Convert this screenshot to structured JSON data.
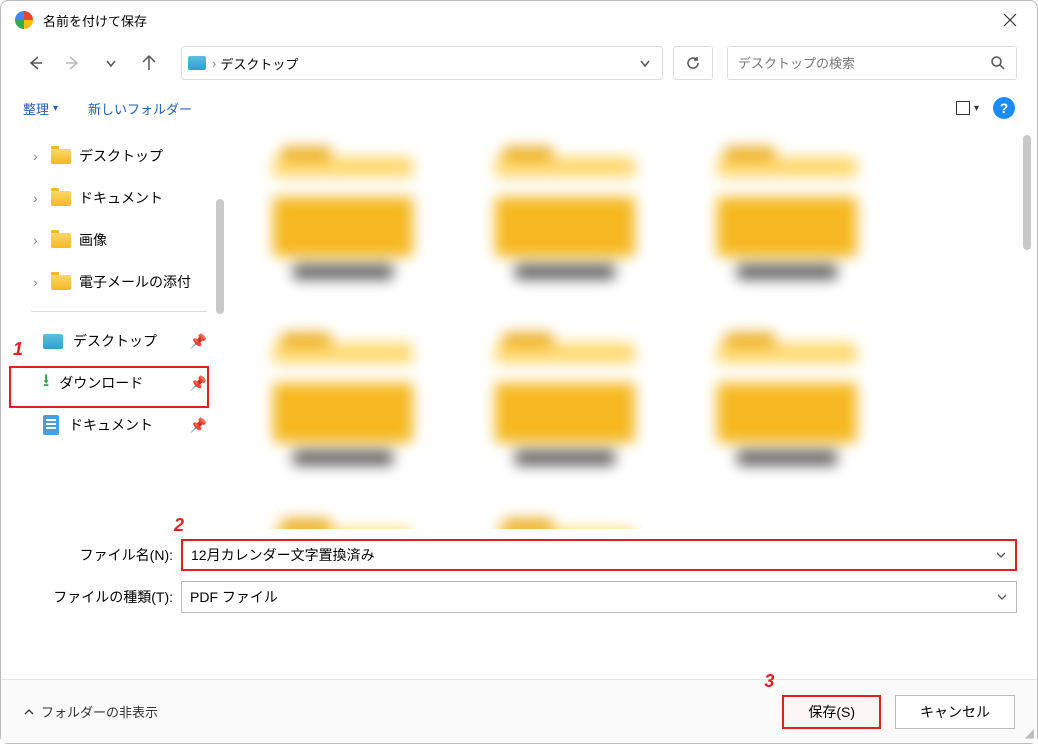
{
  "titlebar": {
    "title": "名前を付けて保存"
  },
  "nav": {
    "breadcrumb": "デスクトップ",
    "search_placeholder": "デスクトップの検索"
  },
  "toolbar": {
    "organize": "整理",
    "new_folder": "新しいフォルダー"
  },
  "sidebar": {
    "tree": [
      {
        "label": "デスクトップ"
      },
      {
        "label": "ドキュメント"
      },
      {
        "label": "画像"
      },
      {
        "label": "電子メールの添付"
      }
    ],
    "quick": [
      {
        "label": "デスクトップ"
      },
      {
        "label": "ダウンロード"
      },
      {
        "label": "ドキュメント"
      }
    ]
  },
  "fields": {
    "filename_label": "ファイル名(N):",
    "filename_value": "12月カレンダー文字置換済み",
    "filetype_label": "ファイルの種類(T):",
    "filetype_value": "PDF ファイル"
  },
  "footer": {
    "hide_folders": "フォルダーの非表示",
    "save": "保存(S)",
    "cancel": "キャンセル"
  },
  "annotations": {
    "a1": "1",
    "a2": "2",
    "a3": "3"
  }
}
